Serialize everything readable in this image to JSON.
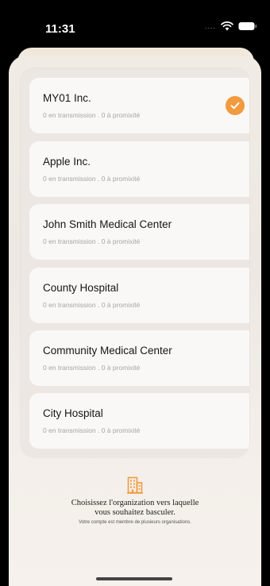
{
  "status_bar": {
    "time": "11:31",
    "signal": "....",
    "icons": [
      "wifi-icon",
      "battery-icon"
    ]
  },
  "organizations": [
    {
      "name": "MY01 Inc.",
      "subtitle": "0 en transmission . 0 à promixité",
      "selected": true
    },
    {
      "name": "Apple Inc.",
      "subtitle": "0 en transmission . 0 à promixité",
      "selected": false
    },
    {
      "name": "John Smith Medical Center",
      "subtitle": "0 en transmission . 0 à promixité",
      "selected": false
    },
    {
      "name": "County Hospital",
      "subtitle": "0 en transmission . 0 à promixité",
      "selected": false
    },
    {
      "name": "Community Medical Center",
      "subtitle": "0 en transmission . 0 à promixité",
      "selected": false
    },
    {
      "name": "City Hospital",
      "subtitle": "0 en transmission . 0 à promixité",
      "selected": false
    }
  ],
  "footer": {
    "icon": "building-icon",
    "message": "Choisissez l'organization vers laquelle vous souhaitez basculer.",
    "note": "Votre compte est membre de plusieurs organisations."
  },
  "colors": {
    "accent": "#f19a3e",
    "card": "#f9f8f6"
  }
}
